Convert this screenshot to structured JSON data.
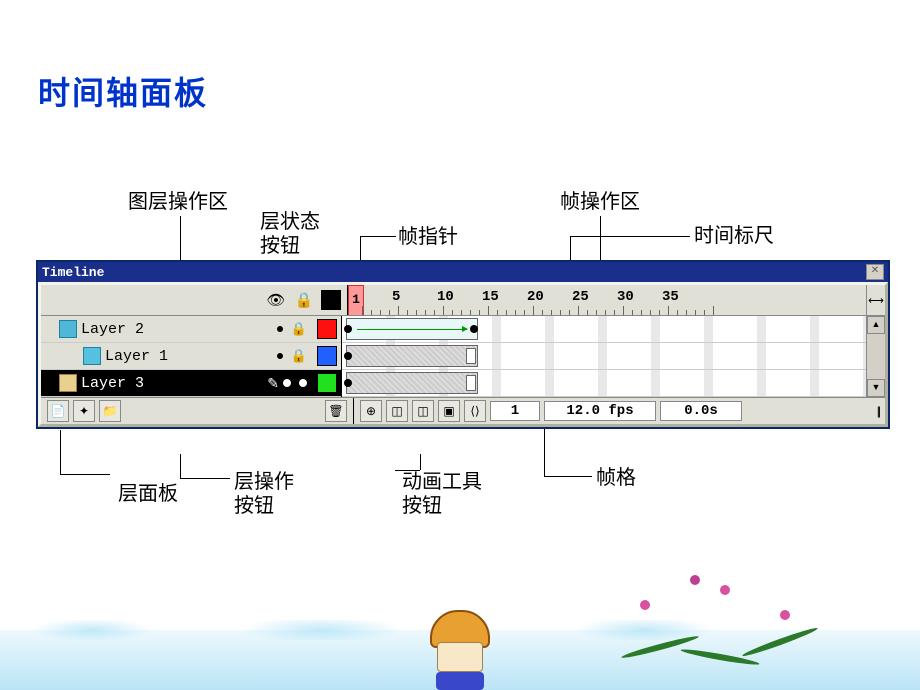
{
  "page_title": "时间轴面板",
  "annotations": {
    "layer_ops_area": "图层操作区",
    "layer_state_btns": "层状态\n按钮",
    "frame_area": "帧操作区",
    "playhead": "帧指针",
    "time_ruler": "时间标尺",
    "layer_panel": "层面板",
    "layer_ops_btns": "层操作\n按钮",
    "anim_tool_btns": "动画工具\n按钮",
    "frame_cell": "帧格"
  },
  "window_title": "Timeline",
  "ruler_marks": [
    "1",
    "5",
    "10",
    "15",
    "20",
    "25",
    "30",
    "35"
  ],
  "current_frame": "1",
  "layers": [
    {
      "name": "Layer 2",
      "color": "#ff1010",
      "locked": true,
      "icon": "t1"
    },
    {
      "name": "Layer 1",
      "color": "#2060ff",
      "locked": true,
      "icon": "t2",
      "indent": true
    },
    {
      "name": "Layer 3",
      "color": "#20e020",
      "selected": true,
      "icon": "folder"
    }
  ],
  "status": {
    "frame": "1",
    "fps": "12.0 fps",
    "time": "0.0s"
  }
}
